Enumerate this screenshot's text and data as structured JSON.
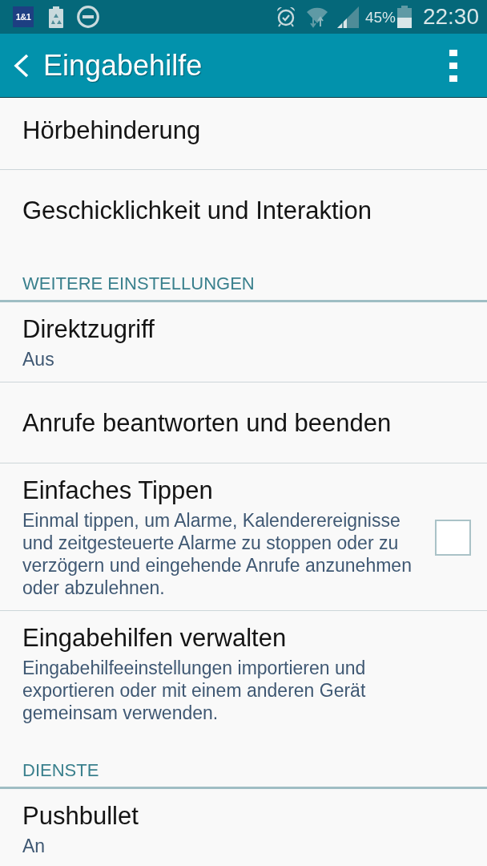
{
  "status_bar": {
    "carrier_logo": "1&1",
    "battery_percent": "45%",
    "time": "22:30"
  },
  "app_bar": {
    "title": "Eingabehilfe"
  },
  "list": [
    {
      "kind": "item",
      "title": "Hörbehinderung"
    },
    {
      "kind": "item",
      "title": "Geschicklichkeit und Interaktion"
    },
    {
      "kind": "header",
      "title": "WEITERE EINSTELLUNGEN"
    },
    {
      "kind": "item",
      "title": "Direktzugriff",
      "summary": "Aus"
    },
    {
      "kind": "item",
      "title": "Anrufe beantworten und beenden"
    },
    {
      "kind": "checkbox",
      "title": "Einfaches Tippen",
      "summary": "Einmal tippen, um Alarme, Kalenderereignisse und zeitgesteuerte Alarme zu stoppen oder zu verzögern und eingehende Anrufe anzunehmen oder abzulehnen.",
      "checked": false
    },
    {
      "kind": "item",
      "title": "Eingabehilfen verwalten",
      "summary": "Eingabehilfeeinstellungen importieren und exportieren oder mit einem anderen Gerät gemeinsam verwenden."
    },
    {
      "kind": "header",
      "title": "DIENSTE"
    },
    {
      "kind": "item",
      "title": "Pushbullet",
      "summary": "An"
    }
  ]
}
